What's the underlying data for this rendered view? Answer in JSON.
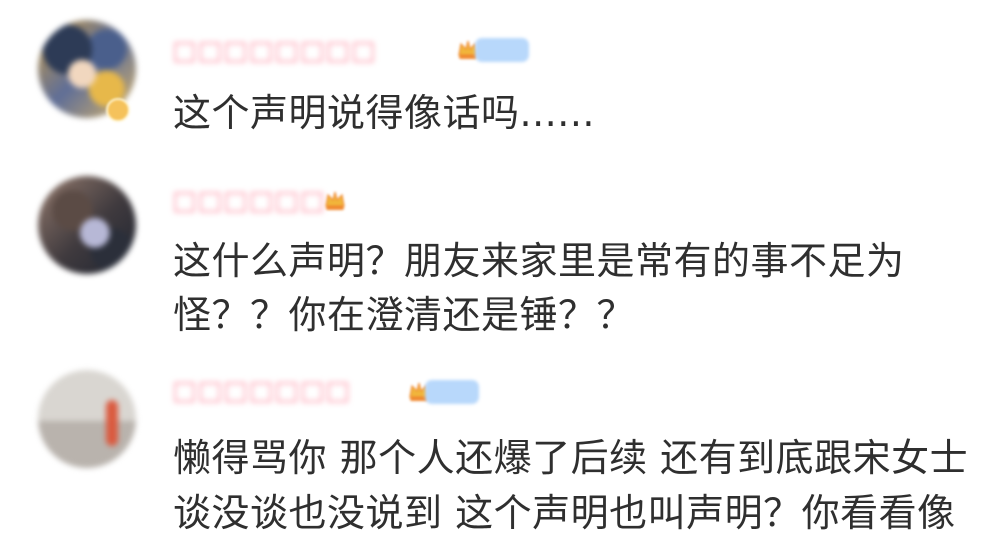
{
  "comments": [
    {
      "text_lines": [
        "这个声明说得像话吗......"
      ],
      "badges": {
        "crown_icon": "crown-icon",
        "level_badge": true
      }
    },
    {
      "text_lines": [
        "这什么声明？朋友来家里是常有的事不足为",
        "怪？？你在澄清还是锤？？"
      ],
      "badges": {
        "crown_icon": "crown-icon",
        "level_badge": false
      }
    },
    {
      "text_lines": [
        "懒得骂你 那个人还爆了后续 还有到底跟宋女士",
        "谈没谈也没说到 这个声明也叫声明？你看看像"
      ],
      "badges": {
        "crown_icon": "crown-icon",
        "level_badge": true
      }
    }
  ]
}
